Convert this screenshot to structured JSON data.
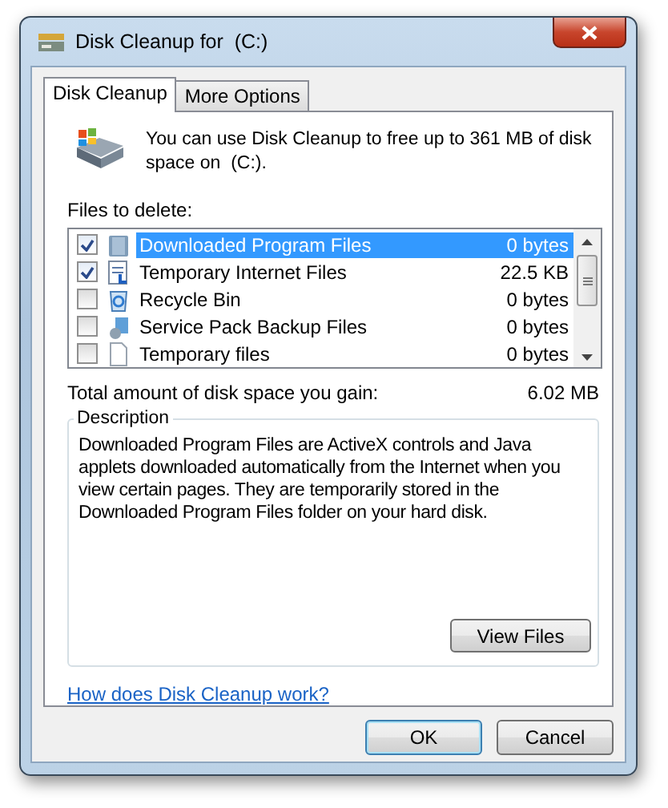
{
  "window": {
    "title": "Disk Cleanup for  (C:)"
  },
  "tabs": [
    {
      "label": "Disk Cleanup",
      "selected": true
    },
    {
      "label": "More Options",
      "selected": false
    }
  ],
  "intro": "You can use Disk Cleanup to free up to 361 MB of disk space on  (C:).",
  "files_label": "Files to delete:",
  "files": [
    {
      "kind": "folder",
      "name": "Downloaded Program Files",
      "size": "0 bytes",
      "checked": true,
      "selected": true
    },
    {
      "kind": "document",
      "name": "Temporary Internet Files",
      "size": "22.5 KB",
      "checked": true,
      "selected": false
    },
    {
      "kind": "recycle",
      "name": "Recycle Bin",
      "size": "0 bytes",
      "checked": false,
      "selected": false
    },
    {
      "kind": "package",
      "name": "Service Pack Backup Files",
      "size": "0 bytes",
      "checked": false,
      "selected": false
    },
    {
      "kind": "blank",
      "name": "Temporary files",
      "size": "0 bytes",
      "checked": false,
      "selected": false
    }
  ],
  "total": {
    "label": "Total amount of disk space you gain:",
    "value": "6.02 MB"
  },
  "description": {
    "title": "Description",
    "text": "Downloaded Program Files are ActiveX controls and Java applets downloaded automatically from the Internet when you view certain pages. They are temporarily stored in the Downloaded Program Files folder on your hard disk."
  },
  "view_files_button": "View Files",
  "help_link": "How does Disk Cleanup work?",
  "buttons": [
    {
      "label": "OK",
      "default": true
    },
    {
      "label": "Cancel",
      "default": false
    }
  ]
}
